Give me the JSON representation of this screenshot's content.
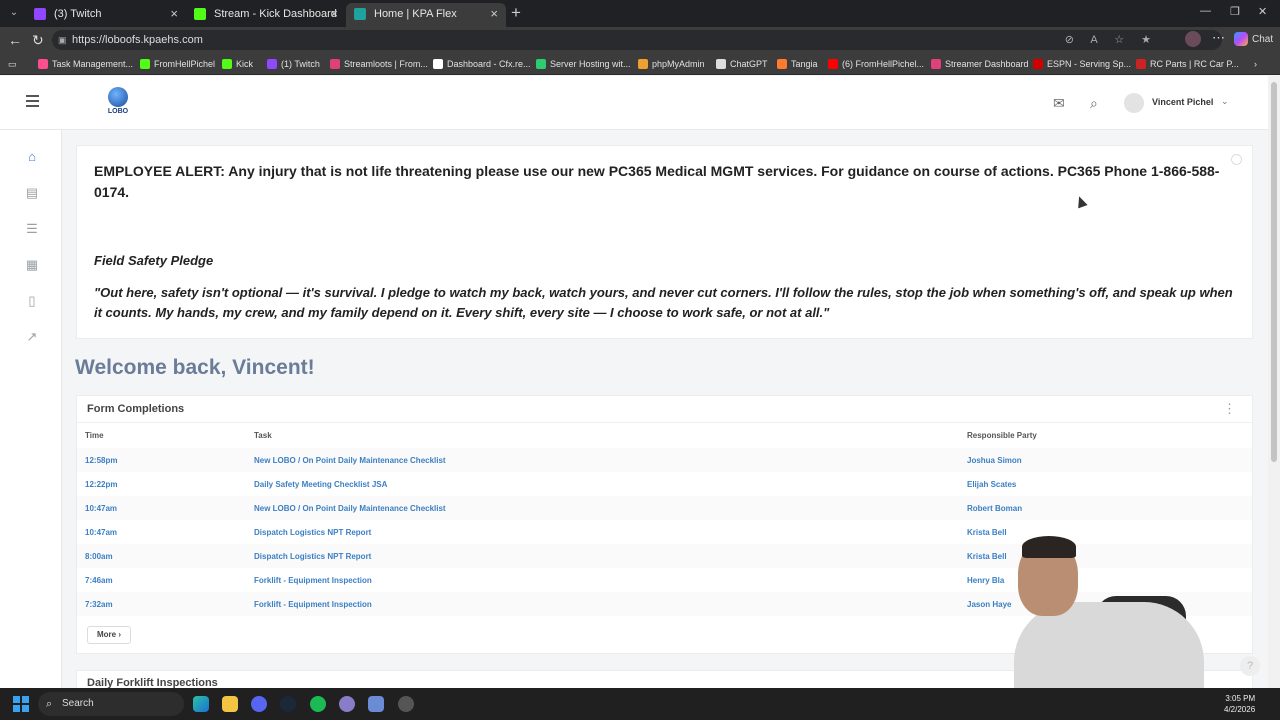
{
  "browser": {
    "tabs": [
      {
        "title": "(3) Twitch",
        "color": "#9146ff"
      },
      {
        "title": "Stream - Kick Dashboard",
        "color": "#53fc18"
      },
      {
        "title": "Home | KPA Flex",
        "color": "#20a39e"
      }
    ],
    "url": "https://loboofs.kpaehs.com",
    "chat_label": "Chat",
    "bookmarks": [
      {
        "label": "Task Management...",
        "color": "#ff4d8d"
      },
      {
        "label": "FromHellPichel",
        "color": "#53fc18"
      },
      {
        "label": "Kick",
        "color": "#53fc18"
      },
      {
        "label": "(1) Twitch",
        "color": "#9146ff"
      },
      {
        "label": "Streamloots | From...",
        "color": "#e0407a"
      },
      {
        "label": "Dashboard - Cfx.re...",
        "color": "#ffffff"
      },
      {
        "label": "Server Hosting wit...",
        "color": "#2ecc71"
      },
      {
        "label": "phpMyAdmin",
        "color": "#f0a030"
      },
      {
        "label": "ChatGPT",
        "color": "#dddddd"
      },
      {
        "label": "Tangia",
        "color": "#ff7b2e"
      },
      {
        "label": "(6) FromHellPichel...",
        "color": "#ff0000"
      },
      {
        "label": "Streamer Dashboard",
        "color": "#e0407a"
      },
      {
        "label": "ESPN - Serving Sp...",
        "color": "#d00000"
      },
      {
        "label": "RC Parts | RC Car P...",
        "color": "#cc2222"
      }
    ]
  },
  "header": {
    "logo_text": "LOBO",
    "user_name": "Vincent Pichel"
  },
  "alert": {
    "text": "EMPLOYEE ALERT: Any injury that is not life threatening please use our new PC365 Medical MGMT services. For guidance on course of actions. PC365 Phone 1-866-588-0174.",
    "pledge_title": "Field Safety Pledge",
    "pledge_quote": "\"Out here, safety isn't optional — it's survival. I pledge to watch my back, watch yours, and never cut corners. I'll follow the rules, stop the job when something's off, and speak up when it counts. My hands, my crew, and my family depend on it. Every shift, every site — I choose to work safe, or not at all.\""
  },
  "welcome": "Welcome back, Vincent!",
  "form_completions": {
    "title": "Form Completions",
    "columns": [
      "Time",
      "Task",
      "Responsible Party"
    ],
    "rows": [
      {
        "time": "12:58pm",
        "task": "New LOBO / On Point Daily Maintenance Checklist",
        "party": "Joshua Simon"
      },
      {
        "time": "12:22pm",
        "task": "Daily Safety Meeting Checklist JSA",
        "party": "Elijah Scates"
      },
      {
        "time": "10:47am",
        "task": "New LOBO / On Point Daily Maintenance Checklist",
        "party": "Robert Boman"
      },
      {
        "time": "10:47am",
        "task": "Dispatch Logistics NPT Report",
        "party": "Krista Bell"
      },
      {
        "time": "8:00am",
        "task": "Dispatch Logistics NPT Report",
        "party": "Krista Bell"
      },
      {
        "time": "7:46am",
        "task": "Forklift - Equipment Inspection",
        "party": "Henry Bla"
      },
      {
        "time": "7:32am",
        "task": "Forklift - Equipment Inspection",
        "party": "Jason Haye"
      }
    ],
    "more_label": "More"
  },
  "forklift_card_title": "Daily Forklift Inspections",
  "taskbar": {
    "search_label": "Search",
    "time": "3:05 PM",
    "date": "4/2/2026"
  }
}
